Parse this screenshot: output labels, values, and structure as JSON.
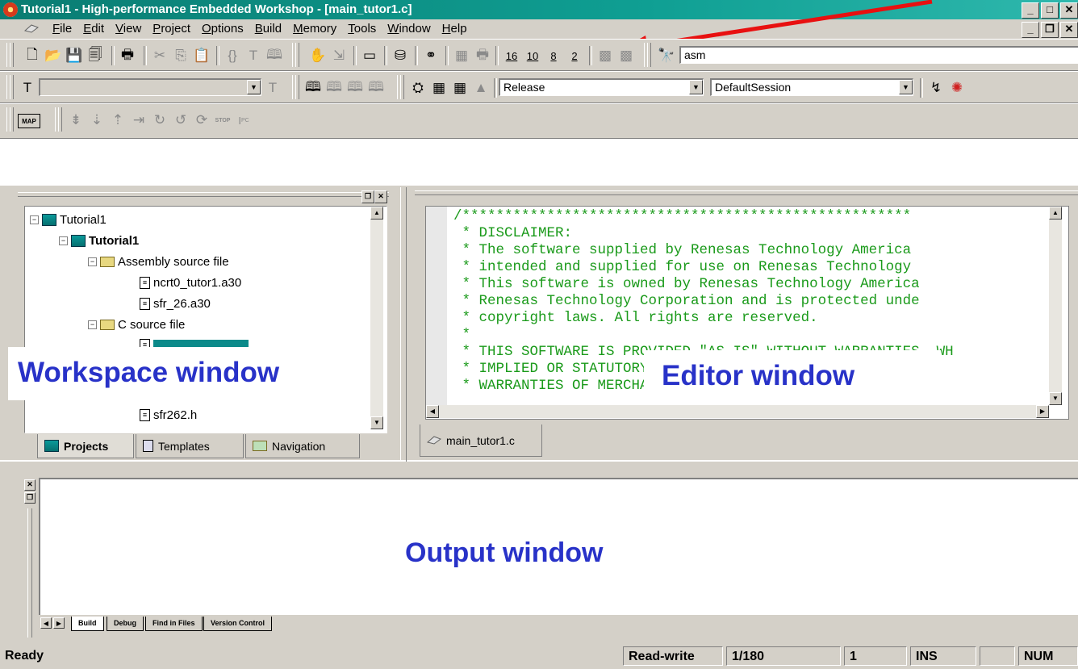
{
  "window": {
    "title": "Tutorial1 - High-performance Embedded Workshop - [main_tutor1.c]",
    "min_glyph": "_",
    "max_glyph": "□",
    "close_glyph": "✕",
    "restore_glyph": "❐"
  },
  "menubar": {
    "items": [
      "File",
      "Edit",
      "View",
      "Project",
      "Options",
      "Build",
      "Memory",
      "Tools",
      "Window",
      "Help"
    ]
  },
  "toolbar1": {
    "icons": [
      "new-file",
      "open-folder",
      "save",
      "save-all",
      "print",
      "cut",
      "copy",
      "paste",
      "braces",
      "text-t",
      "book",
      "hand",
      "debug-reset",
      "console",
      "toolbox",
      "link",
      "watch",
      "print2",
      "radix-16",
      "radix-10",
      "radix-8",
      "radix-2",
      "stop-pane",
      "step-pane",
      "find-binoculars"
    ],
    "radix": [
      "16",
      "10",
      "8",
      "2"
    ],
    "find_value": "asm"
  },
  "toolbar2": {
    "config_combo": "Release",
    "session_combo": "DefaultSession"
  },
  "toolbar3": {
    "map_label": "MAP",
    "stop_label": "STOP",
    "pc_label": "I",
    "pc_sub": "PC"
  },
  "workspace": {
    "tree": [
      {
        "label": "Tutorial1",
        "level": 0,
        "icon": "workspace-icon",
        "bold": false
      },
      {
        "label": "Tutorial1",
        "level": 1,
        "icon": "project-icon",
        "bold": true
      },
      {
        "label": "Assembly source file",
        "level": 2,
        "icon": "folder-icon",
        "bold": false
      },
      {
        "label": "ncrt0_tutor1.a30",
        "level": 3,
        "icon": "file-icon",
        "bold": false
      },
      {
        "label": "sfr_26.a30",
        "level": 3,
        "icon": "file-icon",
        "bold": false
      },
      {
        "label": "C source file",
        "level": 2,
        "icon": "folder-icon",
        "bold": false
      },
      {
        "label": "sfr262.h",
        "level": 3,
        "icon": "file-icon",
        "bold": false
      }
    ],
    "tabs": [
      "Projects",
      "Templates",
      "Navigation"
    ]
  },
  "editor": {
    "lines": [
      "/*****************************************************",
      " * DISCLAIMER:",
      " * The software supplied by Renesas Technology America",
      " * intended and supplied for use on Renesas Technology",
      " * This software is owned by Renesas Technology America",
      " * Renesas Technology Corporation and is protected unde",
      " * copyright laws. All rights are reserved.",
      " *",
      " * THIS SOFTWARE IS PROVIDED \"AS IS\" WITHOUT WARRANTIES, WH",
      " * IMPLIED OR STATUTORY, INCLUDING BUT NOT LIMITED TO I",
      " * WARRANTIES OF MERCHANTABILITY AND FITNESS FOR A PART"
    ],
    "tab_label": "main_tutor1.c"
  },
  "output": {
    "tabs": [
      "Build",
      "Debug",
      "Find in Files",
      "Version Control"
    ]
  },
  "callouts": {
    "workspace": "Workspace window",
    "editor": "Editor window",
    "output": "Output window"
  },
  "statusbar": {
    "status": "Ready",
    "mode": "Read-write",
    "line": "1/180",
    "col": "1",
    "ins": "INS",
    "num": "NUM"
  },
  "colors": {
    "titlebar": "#0a7c72",
    "callout_text": "#2832c8",
    "code_text": "#1a9a1a",
    "arrow": "#e81010"
  }
}
